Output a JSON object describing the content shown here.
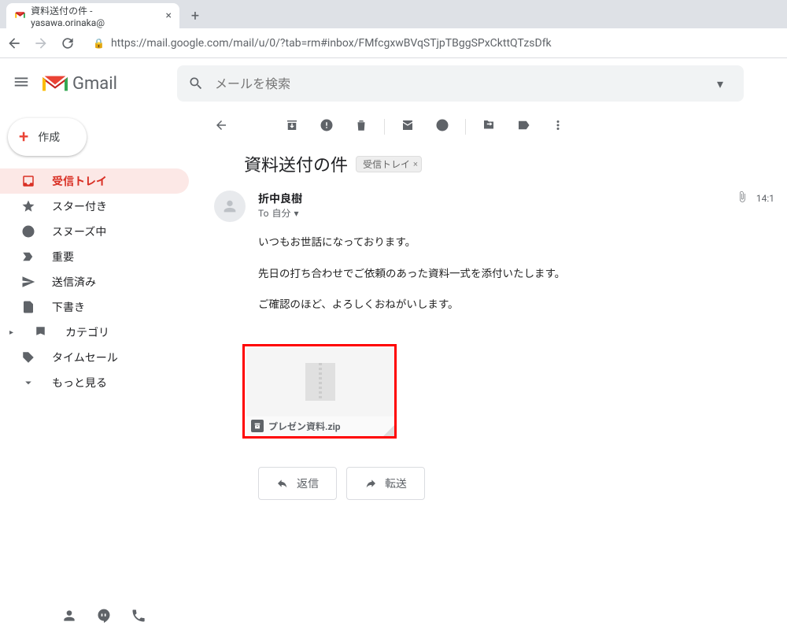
{
  "browser": {
    "tab_title": "資料送付の件 - yasawa.orinaka@",
    "url": "https://mail.google.com/mail/u/0/?tab=rm#inbox/FMfcgxwBVqSTjpTBggSPxCkttQTzsDfk"
  },
  "header": {
    "product_name": "Gmail",
    "search_placeholder": "メールを検索"
  },
  "sidebar": {
    "compose": "作成",
    "items": [
      {
        "label": "受信トレイ"
      },
      {
        "label": "スター付き"
      },
      {
        "label": "スヌーズ中"
      },
      {
        "label": "重要"
      },
      {
        "label": "送信済み"
      },
      {
        "label": "下書き"
      },
      {
        "label": "カテゴリ"
      },
      {
        "label": "タイムセール"
      },
      {
        "label": "もっと見る"
      }
    ]
  },
  "email": {
    "subject": "資料送付の件",
    "label_chip": "受信トレイ",
    "sender_name": "折中良樹",
    "to_prefix": "To",
    "to_value": "自分",
    "time": "14:1",
    "body_lines": [
      "いつもお世話になっております。",
      "先日の打ち合わせでご依頼のあった資料一式を添付いたします。",
      "ご確認のほど、よろしくおねがいします。"
    ],
    "attachment_name": "プレゼン資料.zip",
    "reply": "返信",
    "forward": "転送"
  }
}
